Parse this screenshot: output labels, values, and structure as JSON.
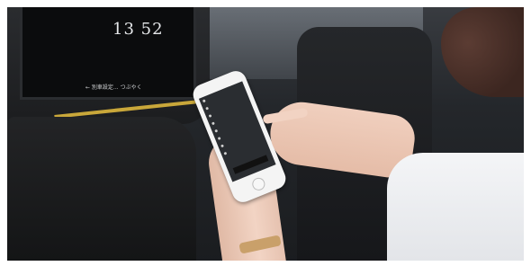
{
  "tablet": {
    "time": "13 52",
    "footer": "← 別車設定... つぶやく"
  },
  "phone": {
    "menu_items": [
      "",
      "",
      "",
      "",
      "",
      "",
      "",
      ""
    ],
    "cta": ""
  },
  "colors": {
    "trim": "#c9a73a",
    "sleeve": "#f4f5f7",
    "interior": "#1a1c1f"
  }
}
